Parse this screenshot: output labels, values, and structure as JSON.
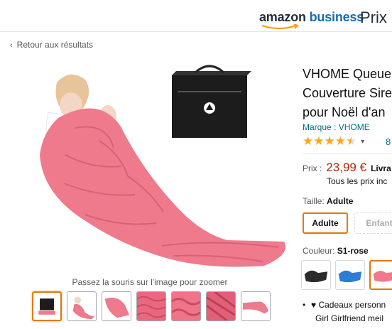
{
  "header": {
    "logo_main": "amazon",
    "logo_business": "business",
    "prix_partial": "Prix l"
  },
  "nav": {
    "back_chevron": "‹",
    "back_label": "Retour aux résultats"
  },
  "gallery": {
    "zoom_hint": "Passez la souris sur l'image pour zoomer",
    "thumbnails": [
      "box",
      "girl-blanket",
      "pink-tail",
      "pink-scales",
      "pink-scales-closeup",
      "pink-weave",
      "pink-flat"
    ],
    "selected_index": 0
  },
  "product": {
    "title_lines": [
      "VHOME Queue",
      "Couverture Sire",
      "pour Noël d'an"
    ],
    "brand": "Marque : VHOME",
    "rating": 4.5,
    "review_count_partial": "8",
    "price_label": "Prix :",
    "price": "23,99 €",
    "delivery_partial": "Livra",
    "tax_note_partial": "Tous les prix inc",
    "size_label": "Taille:",
    "size_selected": "Adulte",
    "size_options": [
      "Adulte",
      "Enfant"
    ],
    "color_label": "Couleur:",
    "color_selected": "S1-rose",
    "color_swatches": [
      "black",
      "blue",
      "pink"
    ],
    "bullets": [
      "♥ Cadeaux personn",
      "Girl Girlfriend meil"
    ]
  },
  "colors": {
    "accent_orange": "#e77600",
    "price_red": "#b12704",
    "link_teal": "#007185",
    "star_gold": "#ffa41c",
    "blanket_pink": "#ee7a8c"
  }
}
